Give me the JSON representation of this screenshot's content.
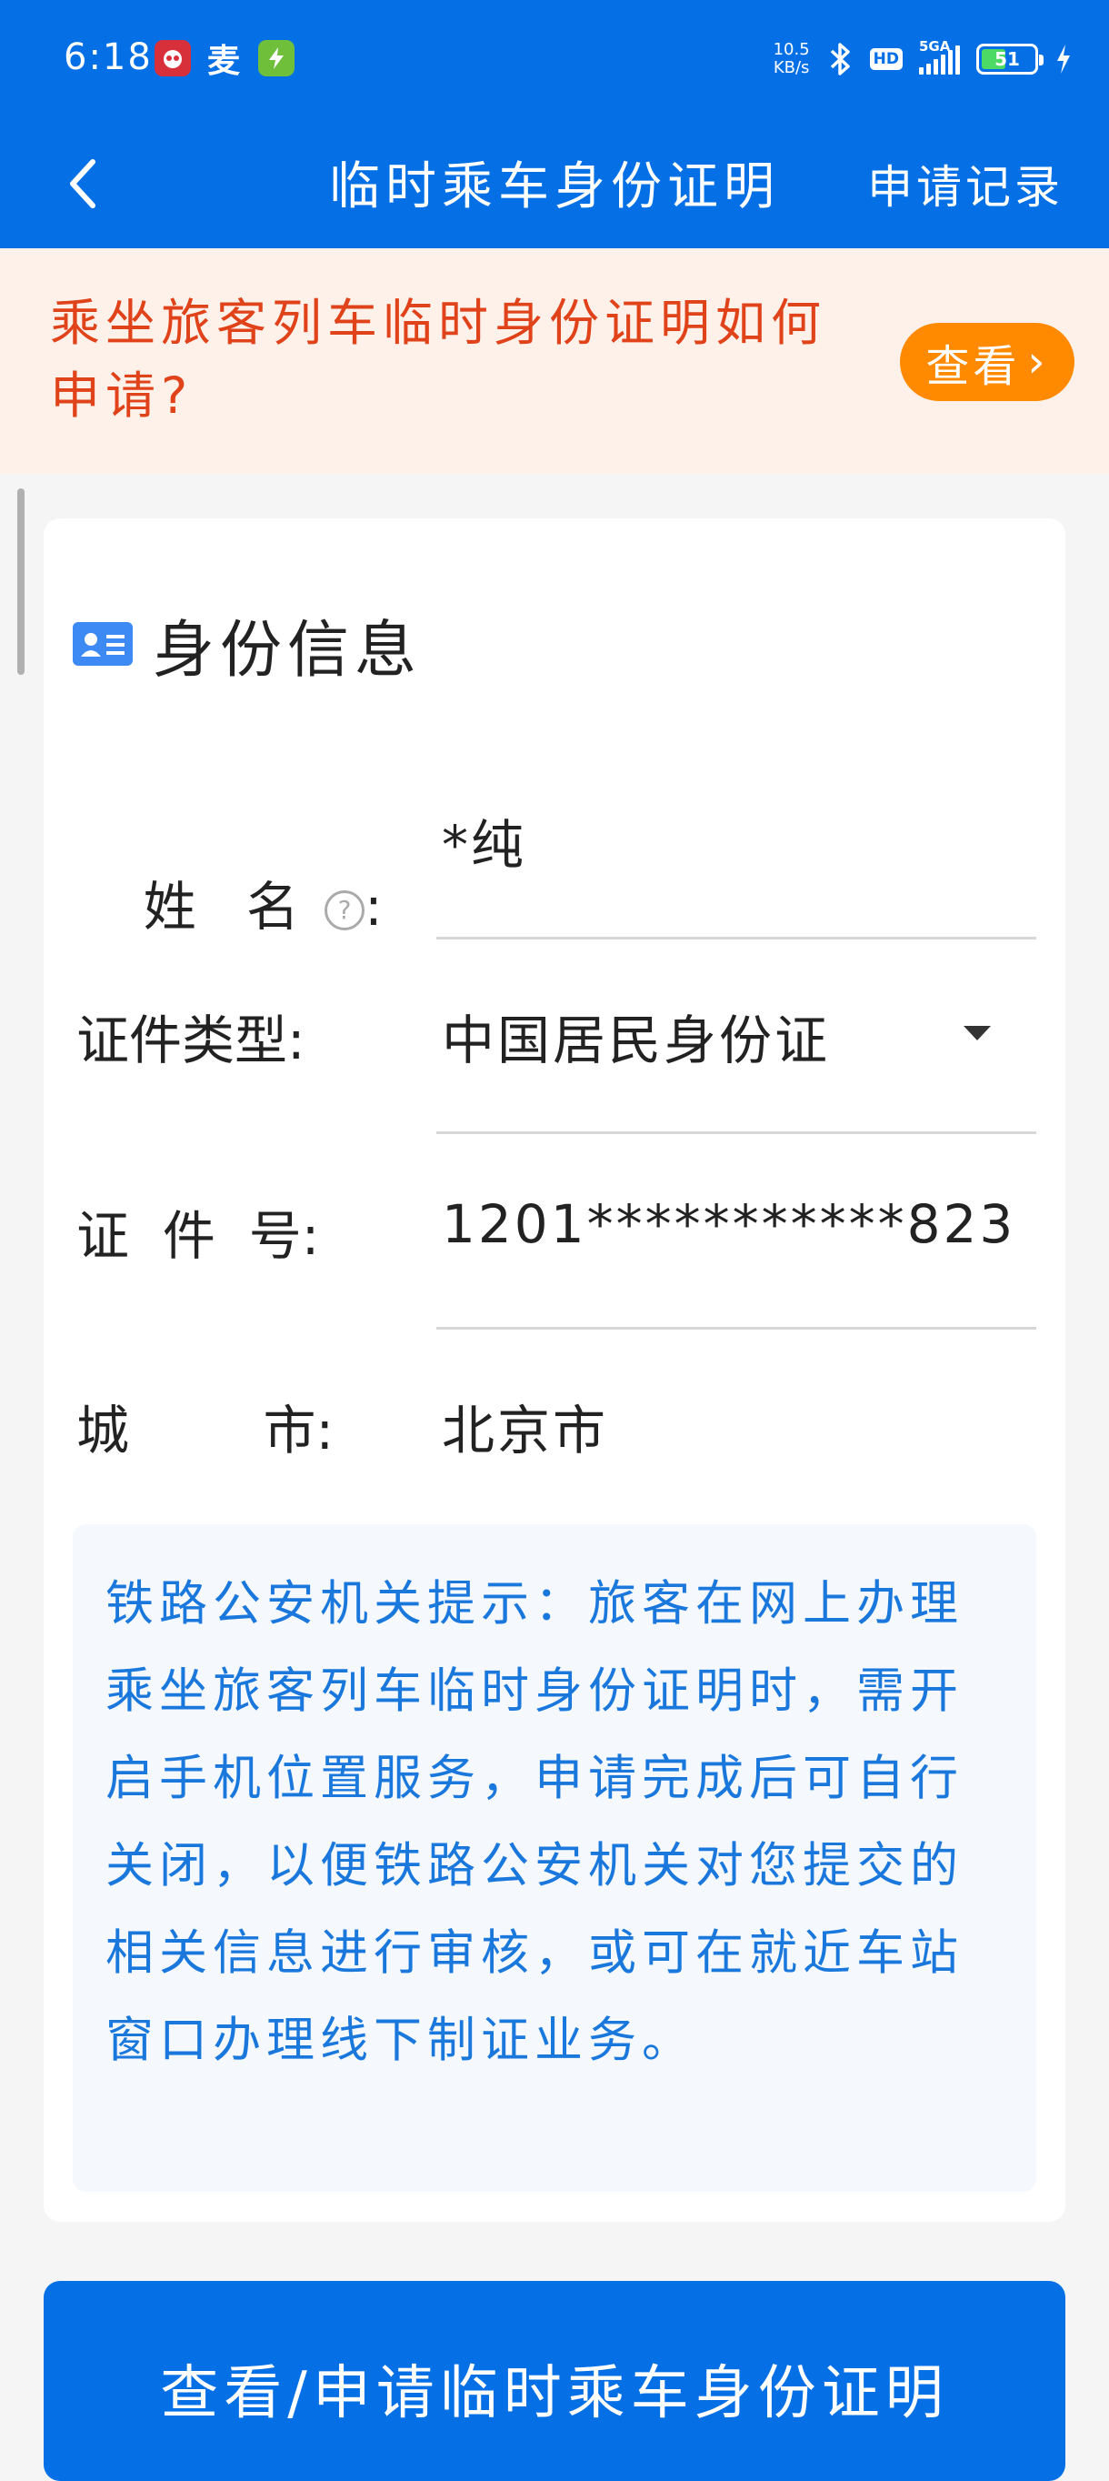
{
  "status_bar": {
    "time": "6:18",
    "net_speed_value": "10.5",
    "net_speed_unit": "KB/s",
    "hd": "HD",
    "signal": "5GA",
    "battery": "51",
    "battery_level": 0.51,
    "app_icons": [
      "red-app-icon",
      "mai-app-icon",
      "green-lightning-app-icon"
    ],
    "app_icon_glyphs": [
      "",
      "麦",
      ""
    ]
  },
  "nav": {
    "title": "临时乘车身份证明",
    "right_action": "申请记录"
  },
  "notice": {
    "text": "乘坐旅客列车临时身份证明如何申请?",
    "button_label": "查看",
    "button_chevron": "›"
  },
  "card": {
    "title": "身份信息",
    "fields": {
      "name": {
        "label": "姓   名",
        "colon": ":",
        "value": "*纯",
        "help": "?"
      },
      "id_type": {
        "label": "证件类型:",
        "value": "中国居民身份证"
      },
      "id_number": {
        "label": "证  件  号:",
        "value": "1201***********823"
      },
      "city": {
        "label": "城        市:",
        "value": "北京市"
      }
    },
    "tip": "铁路公安机关提示：旅客在网上办理乘坐旅客列车临时身份证明时，需开启手机位置服务，申请完成后可自行关闭，以便铁路公安机关对您提交的相关信息进行审核，或可在就近车站窗口办理线下制证业务。"
  },
  "primary_button": {
    "label": "查看/申请临时乘车身份证明"
  },
  "colors": {
    "brand_blue": "#0570e6",
    "notice_bg": "#fdf1ea",
    "notice_text": "#e0421a",
    "notice_button": "#ff8a00",
    "tip_text": "#1a78dd"
  }
}
